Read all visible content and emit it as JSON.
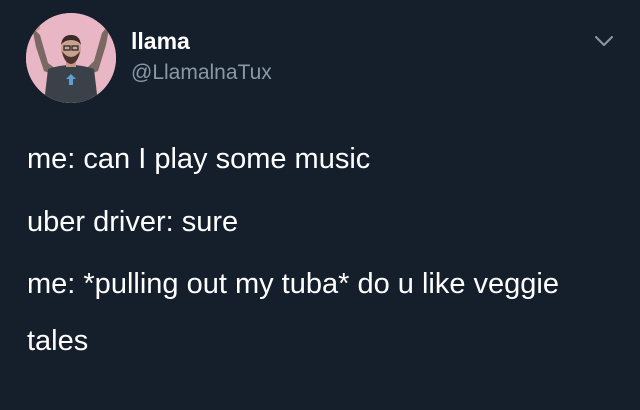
{
  "tweet": {
    "display_name": "llama",
    "handle": "@LlamalnaTux",
    "lines": [
      "me: can I play some music",
      "uber driver: sure",
      "me: *pulling out my tuba* do u like veggie tales"
    ]
  },
  "icons": {
    "menu": "chevron-down-icon",
    "avatar": "profile-photo"
  },
  "colors": {
    "background": "#151f2b",
    "text": "#ffffff",
    "secondary_text": "#8899a6",
    "avatar_background": "#e9b9c6"
  }
}
